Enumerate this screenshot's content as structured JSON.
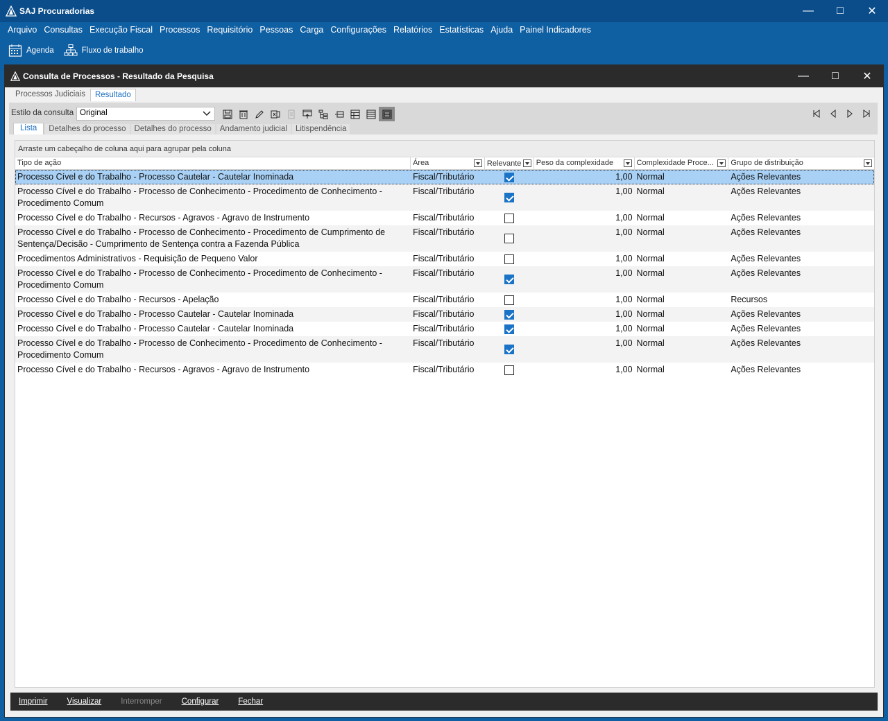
{
  "app": {
    "title": "SAJ Procuradorias",
    "menu": [
      "Arquivo",
      "Consultas",
      "Execução Fiscal",
      "Processos",
      "Requisitório",
      "Pessoas",
      "Carga",
      "Configurações",
      "Relatórios",
      "Estatísticas",
      "Ajuda",
      "Painel Indicadores"
    ],
    "shortcuts": [
      {
        "label": "Agenda",
        "icon": "calendar-icon"
      },
      {
        "label": "Fluxo de trabalho",
        "icon": "workflow-icon"
      }
    ]
  },
  "window": {
    "title": "Consulta de Processos - Resultado da Pesquisa",
    "tabs": [
      "Processos Judiciais",
      "Resultado"
    ],
    "active_tab": 1
  },
  "toolbar": {
    "style_label": "Estilo da consulta",
    "style_value": "Original"
  },
  "subtabs": [
    "Lista",
    "Detalhes do processo",
    "Detalhes do processo",
    "Andamento judicial",
    "Litispendência"
  ],
  "grid": {
    "group_hint": "Arraste um cabeçalho de coluna aqui para agrupar pela coluna",
    "columns": [
      "Tipo de ação",
      "Área",
      "Relevante",
      "Peso da complexidade",
      "Complexidade Proce...",
      "Grupo de distribuição"
    ],
    "rows": [
      {
        "tipo": "Processo Cível e do Trabalho - Processo Cautelar - Cautelar Inominada",
        "area": "Fiscal/Tributário",
        "relevante": true,
        "peso": "1,00",
        "complexidade": "Normal",
        "grupo": "Ações Relevantes"
      },
      {
        "tipo": "Processo Cível e do Trabalho - Processo de Conhecimento - Procedimento de Conhecimento - Procedimento Comum",
        "area": "Fiscal/Tributário",
        "relevante": true,
        "peso": "1,00",
        "complexidade": "Normal",
        "grupo": "Ações Relevantes"
      },
      {
        "tipo": "Processo Cível e do Trabalho - Recursos - Agravos - Agravo de Instrumento",
        "area": "Fiscal/Tributário",
        "relevante": false,
        "peso": "1,00",
        "complexidade": "Normal",
        "grupo": "Ações Relevantes"
      },
      {
        "tipo": "Processo Cível e do Trabalho - Processo de Conhecimento - Procedimento de Cumprimento de Sentença/Decisão - Cumprimento de Sentença contra a Fazenda Pública",
        "area": "Fiscal/Tributário",
        "relevante": false,
        "peso": "1,00",
        "complexidade": "Normal",
        "grupo": "Ações Relevantes"
      },
      {
        "tipo": "Procedimentos Administrativos - Requisição de Pequeno Valor",
        "area": "Fiscal/Tributário",
        "relevante": false,
        "peso": "1,00",
        "complexidade": "Normal",
        "grupo": "Ações Relevantes"
      },
      {
        "tipo": "Processo Cível e do Trabalho - Processo de Conhecimento - Procedimento de Conhecimento - Procedimento Comum",
        "area": "Fiscal/Tributário",
        "relevante": true,
        "peso": "1,00",
        "complexidade": "Normal",
        "grupo": "Ações Relevantes"
      },
      {
        "tipo": "Processo Cível e do Trabalho - Recursos - Apelação",
        "area": "Fiscal/Tributário",
        "relevante": false,
        "peso": "1,00",
        "complexidade": "Normal",
        "grupo": "Recursos"
      },
      {
        "tipo": "Processo Cível e do Trabalho - Processo Cautelar - Cautelar Inominada",
        "area": "Fiscal/Tributário",
        "relevante": true,
        "peso": "1,00",
        "complexidade": "Normal",
        "grupo": "Ações Relevantes"
      },
      {
        "tipo": "Processo Cível e do Trabalho - Processo Cautelar - Cautelar Inominada",
        "area": "Fiscal/Tributário",
        "relevante": true,
        "peso": "1,00",
        "complexidade": "Normal",
        "grupo": "Ações Relevantes"
      },
      {
        "tipo": "Processo Cível e do Trabalho - Processo de Conhecimento - Procedimento de Conhecimento - Procedimento Comum",
        "area": "Fiscal/Tributário",
        "relevante": true,
        "peso": "1,00",
        "complexidade": "Normal",
        "grupo": "Ações Relevantes"
      },
      {
        "tipo": "Processo Cível e do Trabalho - Recursos - Agravos - Agravo de Instrumento",
        "area": "Fiscal/Tributário",
        "relevante": false,
        "peso": "1,00",
        "complexidade": "Normal",
        "grupo": "Ações Relevantes"
      }
    ]
  },
  "footer": {
    "buttons": [
      {
        "label": "Imprimir",
        "enabled": true
      },
      {
        "label": "Visualizar",
        "enabled": true
      },
      {
        "label": "Interromper",
        "enabled": false
      },
      {
        "label": "Configurar",
        "enabled": true
      },
      {
        "label": "Fechar",
        "enabled": true
      }
    ]
  },
  "colors": {
    "accent": "#0f5fa3",
    "selection": "#a9d1f5",
    "checkbox": "#1a73c7"
  }
}
